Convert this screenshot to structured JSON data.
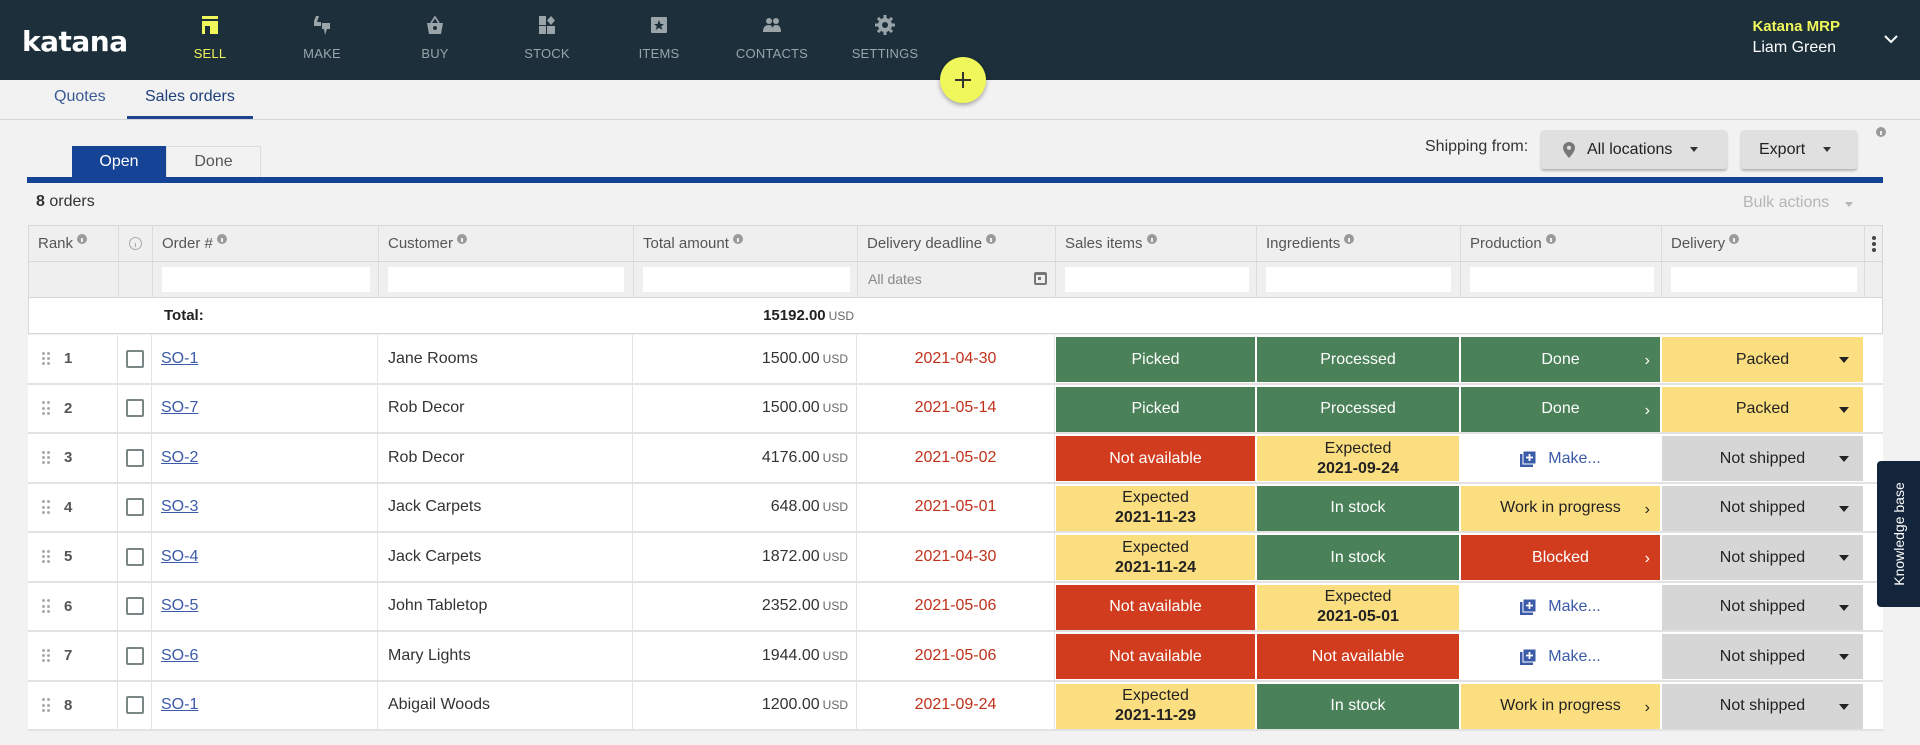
{
  "header": {
    "logo": "katana",
    "nav": [
      {
        "label": "SELL",
        "icon": "shop-icon",
        "active": true
      },
      {
        "label": "MAKE",
        "icon": "make-icon",
        "active": false
      },
      {
        "label": "BUY",
        "icon": "basket-icon",
        "active": false
      },
      {
        "label": "STOCK",
        "icon": "stock-icon",
        "active": false
      },
      {
        "label": "ITEMS",
        "icon": "items-icon",
        "active": false
      },
      {
        "label": "CONTACTS",
        "icon": "contacts-icon",
        "active": false
      },
      {
        "label": "SETTINGS",
        "icon": "gear-icon",
        "active": false
      }
    ],
    "org": "Katana MRP",
    "user": "Liam Green"
  },
  "subnav": {
    "tabs": [
      {
        "label": "Quotes",
        "active": false
      },
      {
        "label": "Sales orders",
        "active": true
      }
    ]
  },
  "toggle": {
    "open": "Open",
    "done": "Done"
  },
  "toolbar": {
    "shipping_label": "Shipping from:",
    "location": "All locations",
    "export": "Export",
    "bulk_actions": "Bulk actions"
  },
  "summary": {
    "count": "8",
    "count_suffix": "orders"
  },
  "table": {
    "columns": [
      "Rank",
      "",
      "Order #",
      "Customer",
      "Total amount",
      "Delivery deadline",
      "Sales items",
      "Ingredients",
      "Production",
      "Delivery"
    ],
    "filter_date_placeholder": "All dates",
    "total_label": "Total:",
    "total_value": "15192.00",
    "currency": "USD",
    "rows": [
      {
        "rank": "1",
        "order": "SO-1",
        "customer": "Jane Rooms",
        "amount": "1500.00",
        "deadline": "2021-04-30",
        "sales": {
          "status": "green",
          "text": "Picked"
        },
        "ingredients": {
          "status": "green",
          "text": "Processed"
        },
        "production": {
          "status": "green",
          "text": "Done",
          "arrow": true
        },
        "delivery": {
          "status": "yellow",
          "text": "Packed"
        }
      },
      {
        "rank": "2",
        "order": "SO-7",
        "customer": "Rob Decor",
        "amount": "1500.00",
        "deadline": "2021-05-14",
        "sales": {
          "status": "green",
          "text": "Picked"
        },
        "ingredients": {
          "status": "green",
          "text": "Processed"
        },
        "production": {
          "status": "green",
          "text": "Done",
          "arrow": true
        },
        "delivery": {
          "status": "yellow",
          "text": "Packed"
        }
      },
      {
        "rank": "3",
        "order": "SO-2",
        "customer": "Rob Decor",
        "amount": "4176.00",
        "deadline": "2021-05-02",
        "sales": {
          "status": "red",
          "text": "Not available"
        },
        "ingredients": {
          "status": "yellow",
          "text": "Expected",
          "date": "2021-09-24"
        },
        "production": {
          "status": "white",
          "text": "Make..."
        },
        "delivery": {
          "status": "grey",
          "text": "Not shipped"
        }
      },
      {
        "rank": "4",
        "order": "SO-3",
        "customer": "Jack Carpets",
        "amount": "648.00",
        "deadline": "2021-05-01",
        "sales": {
          "status": "yellow",
          "text": "Expected",
          "date": "2021-11-23"
        },
        "ingredients": {
          "status": "green",
          "text": "In stock"
        },
        "production": {
          "status": "yellow",
          "text": "Work in progress",
          "arrow": true
        },
        "delivery": {
          "status": "grey",
          "text": "Not shipped"
        }
      },
      {
        "rank": "5",
        "order": "SO-4",
        "customer": "Jack Carpets",
        "amount": "1872.00",
        "deadline": "2021-04-30",
        "sales": {
          "status": "yellow",
          "text": "Expected",
          "date": "2021-11-24"
        },
        "ingredients": {
          "status": "green",
          "text": "In stock"
        },
        "production": {
          "status": "red",
          "text": "Blocked",
          "arrow": true
        },
        "delivery": {
          "status": "grey",
          "text": "Not shipped"
        }
      },
      {
        "rank": "6",
        "order": "SO-5",
        "customer": "John Tabletop",
        "amount": "2352.00",
        "deadline": "2021-05-06",
        "sales": {
          "status": "red",
          "text": "Not available"
        },
        "ingredients": {
          "status": "yellow",
          "text": "Expected",
          "date": "2021-05-01"
        },
        "production": {
          "status": "white",
          "text": "Make..."
        },
        "delivery": {
          "status": "grey",
          "text": "Not shipped"
        }
      },
      {
        "rank": "7",
        "order": "SO-6",
        "customer": "Mary Lights",
        "amount": "1944.00",
        "deadline": "2021-05-06",
        "sales": {
          "status": "red",
          "text": "Not available"
        },
        "ingredients": {
          "status": "red",
          "text": "Not available"
        },
        "production": {
          "status": "white",
          "text": "Make..."
        },
        "delivery": {
          "status": "grey",
          "text": "Not shipped"
        }
      },
      {
        "rank": "8",
        "order": "SO-1",
        "customer": "Abigail Woods",
        "amount": "1200.00",
        "deadline": "2021-09-24",
        "sales": {
          "status": "yellow",
          "text": "Expected",
          "date": "2021-11-29"
        },
        "ingredients": {
          "status": "green",
          "text": "In stock"
        },
        "production": {
          "status": "yellow",
          "text": "Work in progress",
          "arrow": true
        },
        "delivery": {
          "status": "grey",
          "text": "Not shipped"
        }
      }
    ]
  },
  "knowledge_base": "Knowledge base",
  "colors": {
    "header_bg": "#1c2f3a",
    "accent_yellow": "#f0f75a",
    "primary_blue": "#154395",
    "status_green": "#4a8159",
    "status_red": "#d13c1f",
    "status_yellow": "#fbde80",
    "status_grey": "#d6d6d6",
    "deadline_red": "#c0311b"
  }
}
